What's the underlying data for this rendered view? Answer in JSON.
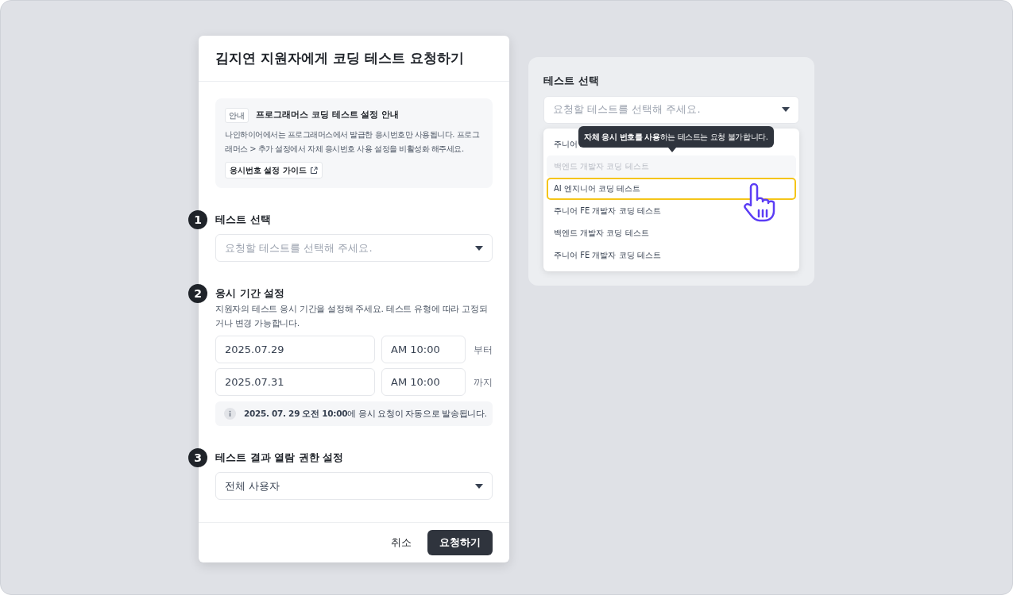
{
  "dialog": {
    "title": "김지연 지원자에게 코딩 테스트 요청하기",
    "notice": {
      "badge": "안내",
      "title": "프로그래머스 코딩 테스트 설정 안내",
      "body": "나인하이어에서는 프로그래머스에서 발급한 응시번호만 사용됩니다. 프로그래머스 > 추가 설정에서 자체 응시번호 사용 설정을 비활성화 해주세요.",
      "link": "응시번호 설정 가이드"
    },
    "sections": [
      {
        "number": "1",
        "title": "테스트 선택",
        "kind": "select",
        "placeholder": "요청할 테스트를 선택해 주세요."
      },
      {
        "number": "2",
        "title": "응시 기간 설정",
        "kind": "period",
        "description": "지원자의 테스트 응시 기간을 설정해 주세요. 테스트 유형에 따라 고정되거나 변경 가능합니다.",
        "rows": [
          {
            "date": "2025.07.29",
            "time": "AM 10:00",
            "suffix": "부터"
          },
          {
            "date": "2025.07.31",
            "time": "AM 10:00",
            "suffix": "까지"
          }
        ],
        "info": "**2025. 07. 29 오전 10:00**에 응시 요청이 자동으로 발송됩니다."
      },
      {
        "number": "3",
        "title": "테스트 결과 열람 권한 설정",
        "kind": "select",
        "value": "전체 사용자"
      }
    ],
    "buttons": {
      "cancel": "취소",
      "submit": "요청하기"
    }
  },
  "panel": {
    "label": "테스트 선택",
    "placeholder": "요청할 테스트를 선택해 주세요.",
    "tooltip": "**자체 응시 번호를 사용**하는 테스트는 요청 불가합니다.",
    "options": [
      {
        "label": "주니어",
        "disabled": false,
        "highlighted": false
      },
      {
        "label": "백엔드 개발자 코딩 테스트",
        "disabled": true,
        "highlighted": false
      },
      {
        "label": "AI 엔지니어 코딩 테스트",
        "disabled": false,
        "highlighted": true
      },
      {
        "label": "주니어 FE 개발자 코딩 테스트",
        "disabled": false,
        "highlighted": false
      },
      {
        "label": "백엔드 개발자 코딩 테스트",
        "disabled": false,
        "highlighted": false
      },
      {
        "label": "주니어 FE 개발자 코딩 테스트",
        "disabled": false,
        "highlighted": false
      }
    ]
  }
}
